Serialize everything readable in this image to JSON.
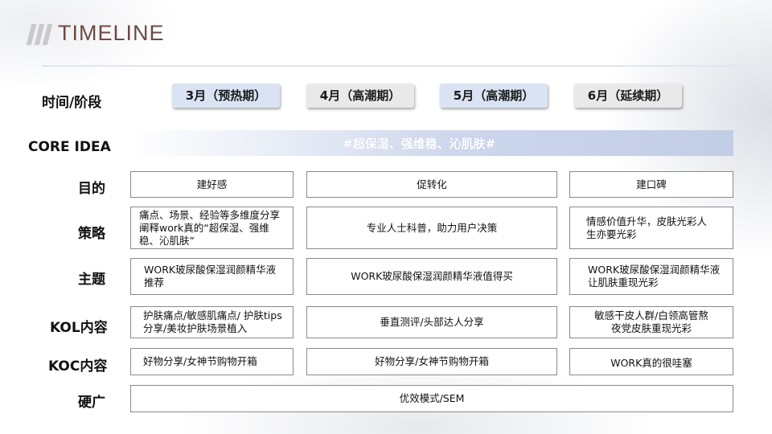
{
  "header": {
    "title": "TIMELINE"
  },
  "row_labels": {
    "phase": "时间/阶段",
    "core": "CORE IDEA",
    "purpose": "目的",
    "strategy": "策略",
    "theme": "主题",
    "kol": "KOL内容",
    "koc": "KOC内容",
    "ads": "硬广"
  },
  "phases": [
    "3月（预热期）",
    "4月（高潮期）",
    "5月（高潮期）",
    "6月（延续期）"
  ],
  "core_idea": "#超保湿、强维稳、沁肌肤#",
  "purpose": [
    "建好感",
    "促转化",
    "建口碑"
  ],
  "strategy": [
    "痛点、场景、经验等多维度分享 阐释work真的“超保湿、强维稳、沁肌肤”",
    "专业人士科普，助力用户决策",
    "情感价值升华，皮肤光彩人生亦要光彩"
  ],
  "theme": [
    "WORK玻尿酸保湿润颜精华液推荐",
    "WORK玻尿酸保湿润颜精华液值得买",
    "WORK玻尿酸保湿润颜精华液让肌肤重现光彩"
  ],
  "kol": [
    "护肤痛点/敏感肌痛点/ 护肤tips分享/美妆护肤场景植入",
    "垂直测评/头部达人分享",
    "敏感干皮人群/白领高管熬夜党皮肤重现光彩"
  ],
  "koc": [
    "好物分享/女神节购物开箱",
    "好物分享/女神节购物开箱",
    "WORK真的很哇塞"
  ],
  "ads": "优效模式/SEM",
  "colors": {
    "title": "#6e4a45",
    "phase_blue": "#d9e3f3",
    "phase_gray": "#e9e9ea",
    "core_bar": "#c2cde6"
  }
}
